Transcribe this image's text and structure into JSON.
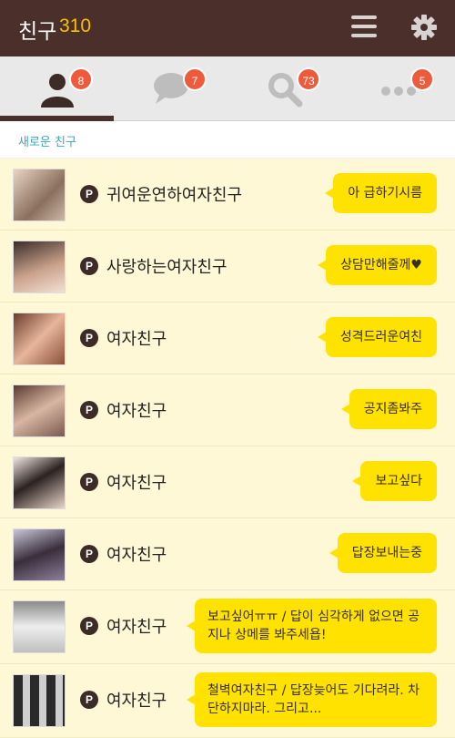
{
  "header": {
    "title": "친구",
    "count": "310"
  },
  "tabs": [
    {
      "name": "friends",
      "badge": "8"
    },
    {
      "name": "chats",
      "badge": "7"
    },
    {
      "name": "search",
      "badge": "73"
    },
    {
      "name": "more",
      "badge": "5"
    }
  ],
  "section_label": "새로운 친구",
  "friends": [
    {
      "name": "귀여운연하여자친구",
      "status": "아 급하기시름"
    },
    {
      "name": "사랑하는여자친구",
      "status": "상담만해줄께♥"
    },
    {
      "name": "여자친구",
      "status": "성격드러운여친"
    },
    {
      "name": "여자친구",
      "status": "공지좀봐주"
    },
    {
      "name": "여자친구",
      "status": "보고싶다"
    },
    {
      "name": "여자친구",
      "status": "답장보내는중"
    },
    {
      "name": "여자친구",
      "status": "보고싶어ㅠㅠ / 답이 심각하게 없으면 공지나 상메를 봐주세욥!"
    },
    {
      "name": "여자친구",
      "status": "철벽여자친구 / 답장늦어도 기다려라. 차단하지마라. 그리고..."
    }
  ]
}
